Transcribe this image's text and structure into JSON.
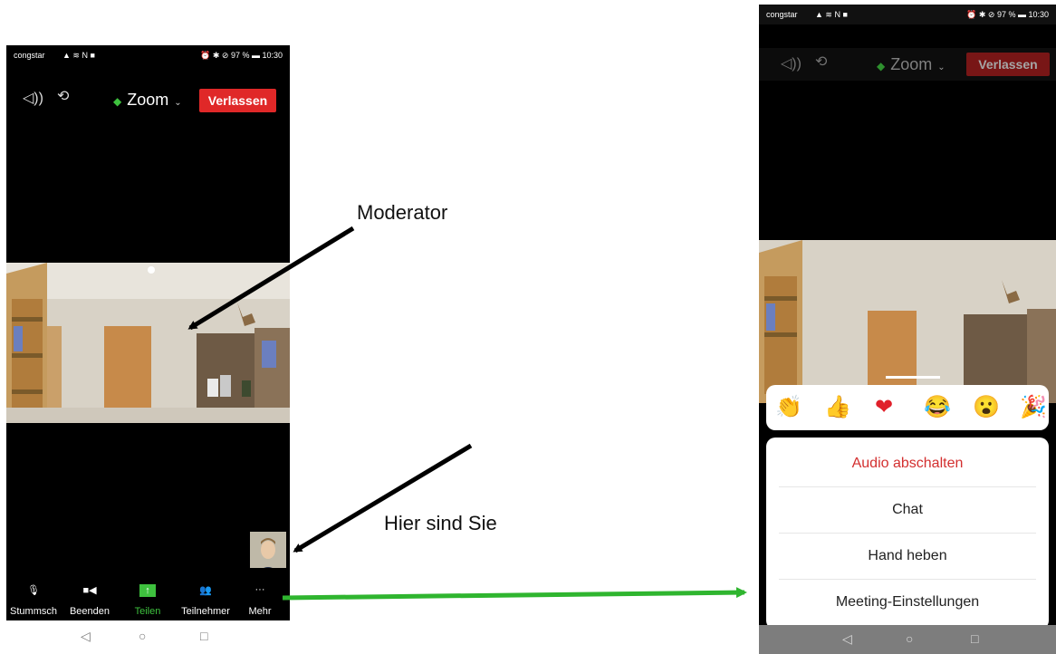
{
  "status_bar": {
    "carrier": "congstar",
    "signal_icons": "▲ ≋ N ■",
    "right": "⏰ ✱ ⊘ 97 % ▬ 10:30"
  },
  "topbar": {
    "speaker_icon": "speaker-icon",
    "camera_switch_icon": "camera-switch-icon",
    "title": "Zoom",
    "chevron": "⌄",
    "leave_label": "Verlassen"
  },
  "toolbar": {
    "items": [
      {
        "label": "Stummsch",
        "icon": "microphone-icon"
      },
      {
        "label": "Beenden",
        "icon": "video-camera-icon"
      },
      {
        "label": "Teilen",
        "icon": "share-icon"
      },
      {
        "label": "Teilnehmer",
        "icon": "participants-icon"
      },
      {
        "label": "Mehr",
        "icon": "more-icon"
      }
    ],
    "share_color": "#3ec13e"
  },
  "nav": {
    "back": "◁",
    "home": "○",
    "recent": "□"
  },
  "annotations": {
    "moderator": "Moderator",
    "hier_sind_sie": "Hier sind Sie"
  },
  "reactions": [
    "👏",
    "👍",
    "❤",
    "😂",
    "😮",
    "🎉"
  ],
  "menu": {
    "items": [
      "Audio abschalten",
      "Chat",
      "Hand heben",
      "Meeting-Einstellungen"
    ],
    "highlight_color": "#d32f2f"
  },
  "colors": {
    "leave": "#e02828",
    "arrow_black": "#000000",
    "arrow_green": "#2fb52f"
  }
}
